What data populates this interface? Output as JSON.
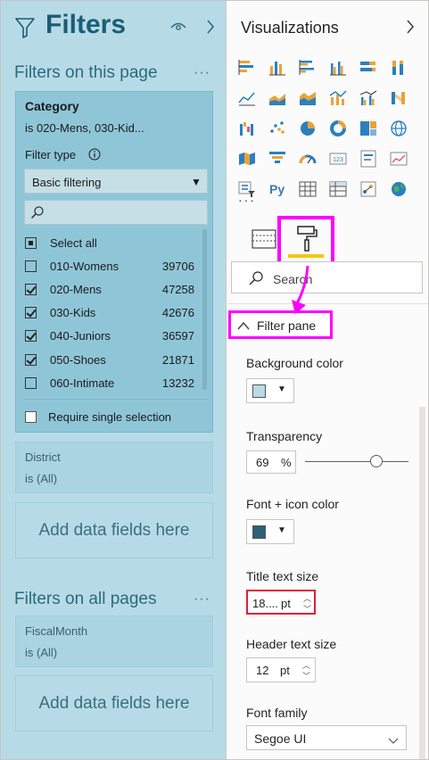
{
  "filters_pane": {
    "title": "Filters",
    "section_page": "Filters on this page",
    "section_all": "Filters on all pages",
    "more_options": "···",
    "category_card": {
      "name": "Category",
      "description": "is 020-Mens, 030-Kid...",
      "filter_type_label": "Filter type",
      "filter_type_value": "Basic filtering",
      "select_all": "Select all",
      "items": [
        {
          "label": "010-Womens",
          "count": "39706",
          "checked": false
        },
        {
          "label": "020-Mens",
          "count": "47258",
          "checked": true
        },
        {
          "label": "030-Kids",
          "count": "42676",
          "checked": true
        },
        {
          "label": "040-Juniors",
          "count": "36597",
          "checked": true
        },
        {
          "label": "050-Shoes",
          "count": "21871",
          "checked": true
        },
        {
          "label": "060-Intimate",
          "count": "13232",
          "checked": false
        }
      ],
      "require_single": "Require single selection"
    },
    "district_card": {
      "name": "District",
      "value": "is (All)"
    },
    "fiscalmonth_card": {
      "name": "FiscalMonth",
      "value": "is (All)"
    },
    "add_fields_1": "Add data fields here",
    "add_fields_2": "Add data fields here"
  },
  "viz_pane": {
    "title": "Visualizations",
    "more": "···",
    "search_placeholder": "Search",
    "section_header": "Filter pane",
    "background_color_label": "Background color",
    "background_color": "#b7dbe6",
    "transparency_label": "Transparency",
    "transparency_value": "69",
    "transparency_unit": "%",
    "transparency_level": 0.69,
    "font_icon_color_label": "Font + icon color",
    "font_icon_color": "#2b6277",
    "title_size_label": "Title text size",
    "title_size_value": "18....",
    "title_size_unit": "pt",
    "header_size_label": "Header text size",
    "header_size_value": "12",
    "header_size_unit": "pt",
    "font_family_label": "Font family",
    "font_family_value": "Segoe UI"
  },
  "colors": {
    "highlight": "#ff00ff",
    "accent_yellow": "#f2c811",
    "filters_bg": "#b7dbe6",
    "title_blue": "#1b5d74"
  }
}
